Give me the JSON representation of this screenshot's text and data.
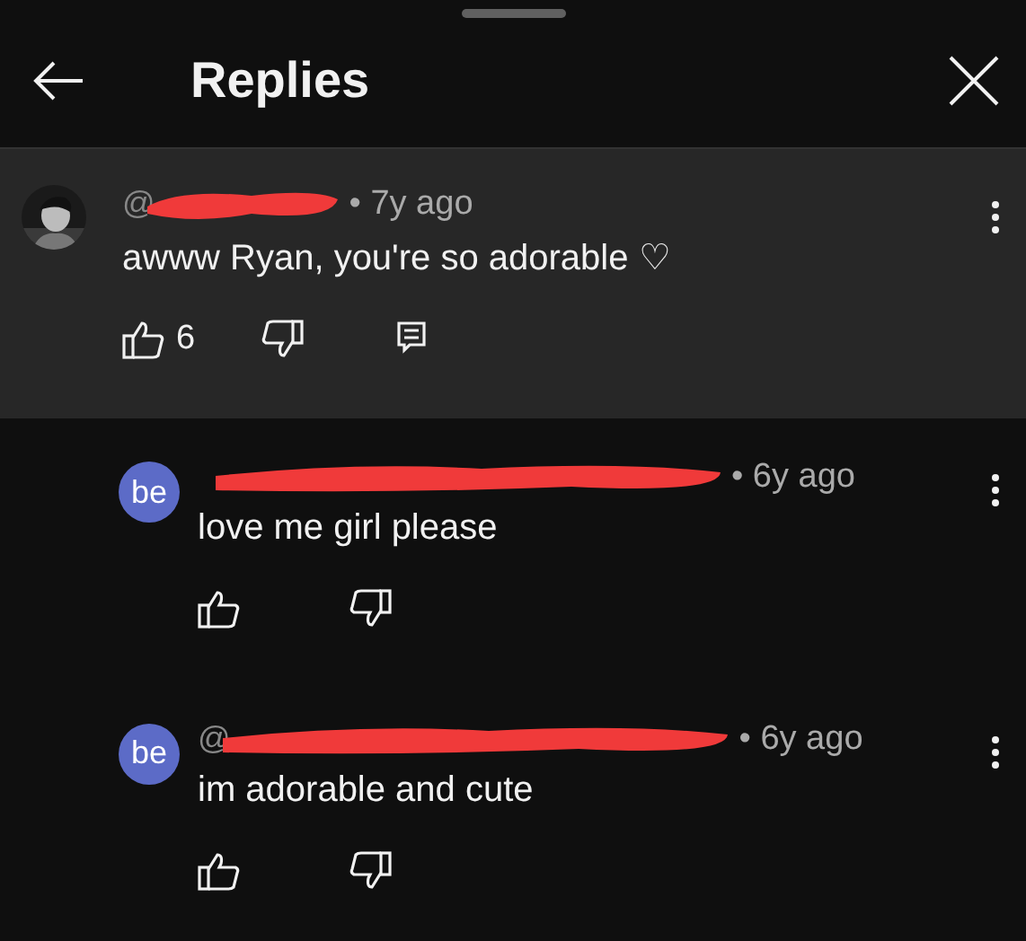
{
  "header": {
    "title": "Replies"
  },
  "comments": [
    {
      "kind": "parent",
      "handle_visible": "@",
      "time": "• 7y ago",
      "text": "awww Ryan, you're so adorable ♡",
      "likes": "6",
      "reply_action": true
    },
    {
      "kind": "reply",
      "avatar": {
        "kind": "initials",
        "initials": "be",
        "color": "#5c6bc7"
      },
      "time": "• 6y ago",
      "text": "love me girl please",
      "reply_action": false
    },
    {
      "kind": "reply",
      "avatar": {
        "kind": "initials",
        "initials": "be",
        "color": "#5c6bc7"
      },
      "handle_visible": "@",
      "time": "• 6y ago",
      "text": "im adorable and cute",
      "reply_action": false
    }
  ]
}
